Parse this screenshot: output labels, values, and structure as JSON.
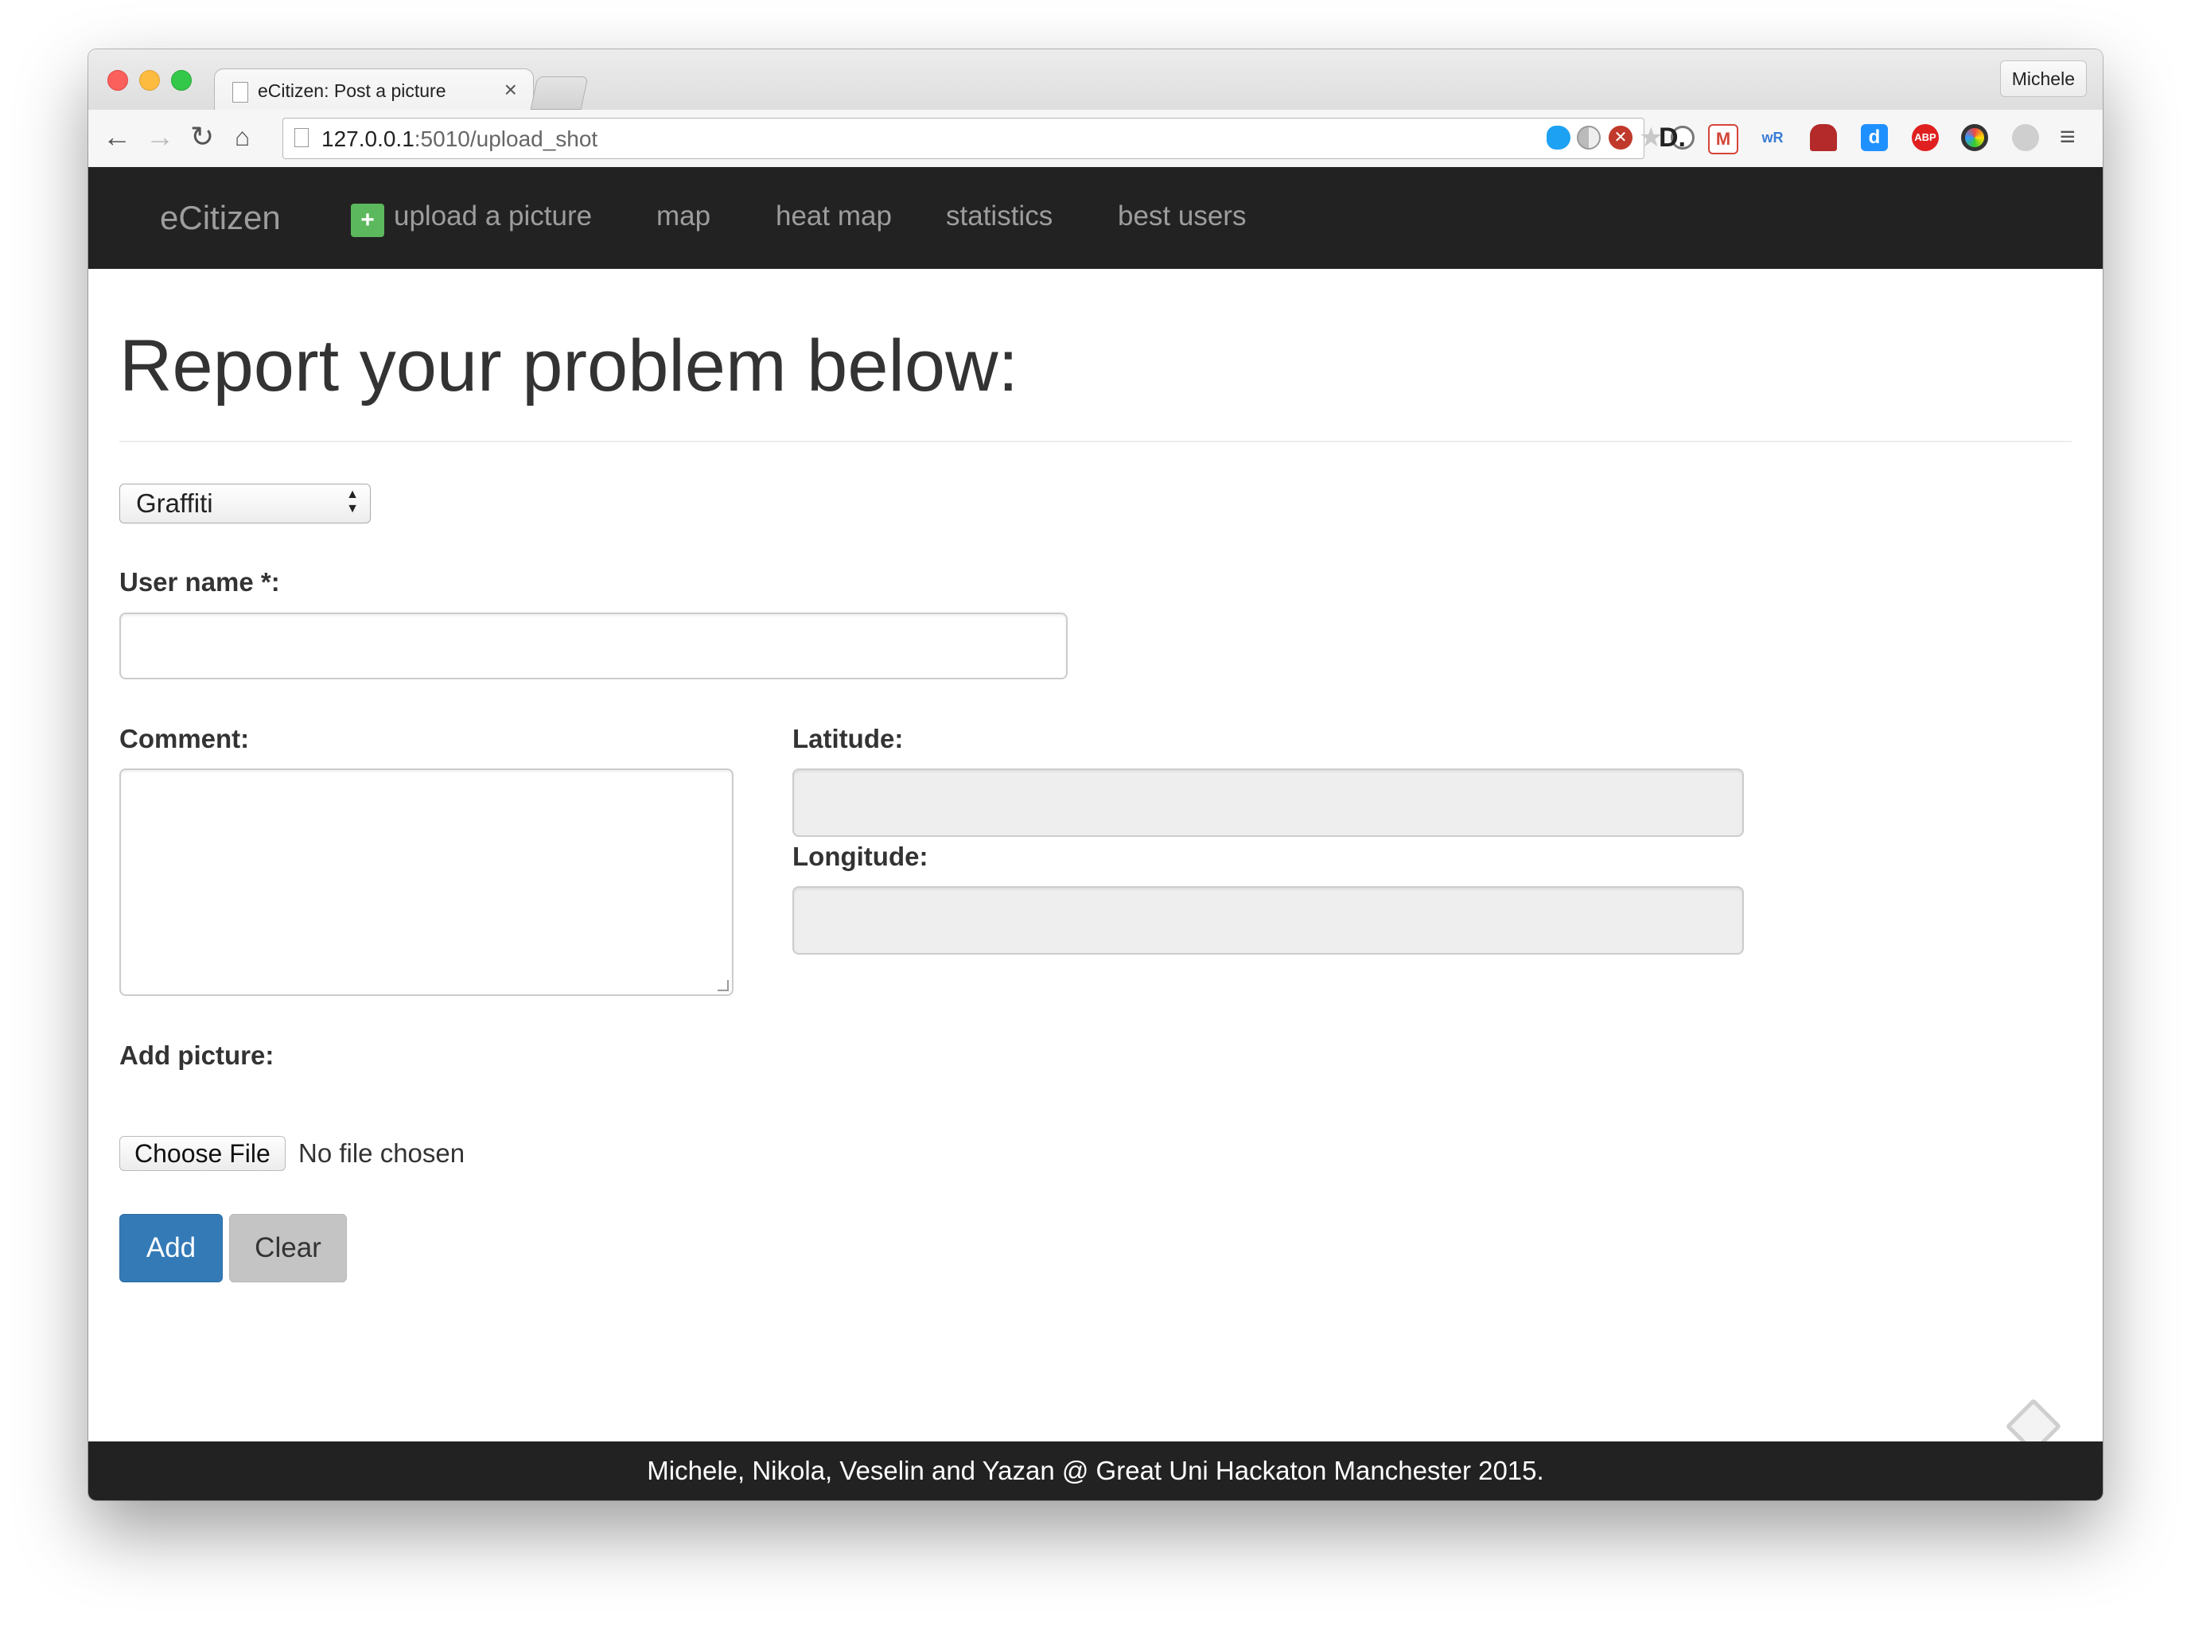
{
  "browser": {
    "tab_title": "eCitizen: Post a picture",
    "tab_close": "×",
    "profile_name": "Michele",
    "url_host": "127.0.0.1",
    "url_rest": ":5010/upload_shot",
    "extensions": [
      "twitter-icon",
      "contrast-icon",
      "block-icon",
      "star-icon",
      "zoom-icon",
      "d-icon",
      "gmail-icon",
      "wr-icon",
      "sofa-icon",
      "d-blue-icon",
      "abp-icon",
      "circle-icon",
      "chat-icon"
    ],
    "ext_labels": {
      "d": "D.",
      "wr": "wR",
      "abp": "ABP"
    }
  },
  "nav": {
    "brand": "eCitizen",
    "plus": "+",
    "items": [
      "upload a picture",
      "map",
      "heat map",
      "statistics",
      "best users"
    ]
  },
  "form": {
    "heading": "Report your problem below:",
    "category_selected": "Graffiti",
    "username_label": "User name *:",
    "username_value": "",
    "comment_label": "Comment:",
    "comment_value": "",
    "latitude_label": "Latitude:",
    "latitude_value": "",
    "longitude_label": "Longitude:",
    "longitude_value": "",
    "picture_label": "Add picture:",
    "file_button": "Choose File",
    "file_status": "No file chosen",
    "add_button": "Add",
    "clear_button": "Clear"
  },
  "footer": {
    "text": "Michele, Nikola, Veselin and Yazan @ Great Uni Hackaton Manchester 2015."
  },
  "colors": {
    "navbar_bg": "#222222",
    "primary": "#337ab7",
    "success": "#5cb85c",
    "disabled_bg": "#eeeeee"
  }
}
